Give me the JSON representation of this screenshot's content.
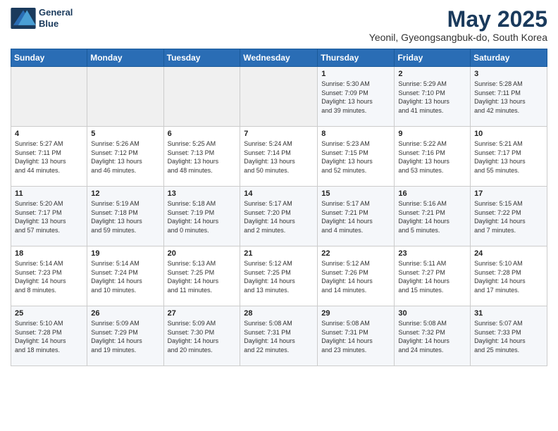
{
  "logo": {
    "line1": "General",
    "line2": "Blue"
  },
  "title": "May 2025",
  "subtitle": "Yeonil, Gyeongsangbuk-do, South Korea",
  "headers": [
    "Sunday",
    "Monday",
    "Tuesday",
    "Wednesday",
    "Thursday",
    "Friday",
    "Saturday"
  ],
  "weeks": [
    [
      {
        "day": "",
        "content": ""
      },
      {
        "day": "",
        "content": ""
      },
      {
        "day": "",
        "content": ""
      },
      {
        "day": "",
        "content": ""
      },
      {
        "day": "1",
        "content": "Sunrise: 5:30 AM\nSunset: 7:09 PM\nDaylight: 13 hours\nand 39 minutes."
      },
      {
        "day": "2",
        "content": "Sunrise: 5:29 AM\nSunset: 7:10 PM\nDaylight: 13 hours\nand 41 minutes."
      },
      {
        "day": "3",
        "content": "Sunrise: 5:28 AM\nSunset: 7:11 PM\nDaylight: 13 hours\nand 42 minutes."
      }
    ],
    [
      {
        "day": "4",
        "content": "Sunrise: 5:27 AM\nSunset: 7:11 PM\nDaylight: 13 hours\nand 44 minutes."
      },
      {
        "day": "5",
        "content": "Sunrise: 5:26 AM\nSunset: 7:12 PM\nDaylight: 13 hours\nand 46 minutes."
      },
      {
        "day": "6",
        "content": "Sunrise: 5:25 AM\nSunset: 7:13 PM\nDaylight: 13 hours\nand 48 minutes."
      },
      {
        "day": "7",
        "content": "Sunrise: 5:24 AM\nSunset: 7:14 PM\nDaylight: 13 hours\nand 50 minutes."
      },
      {
        "day": "8",
        "content": "Sunrise: 5:23 AM\nSunset: 7:15 PM\nDaylight: 13 hours\nand 52 minutes."
      },
      {
        "day": "9",
        "content": "Sunrise: 5:22 AM\nSunset: 7:16 PM\nDaylight: 13 hours\nand 53 minutes."
      },
      {
        "day": "10",
        "content": "Sunrise: 5:21 AM\nSunset: 7:17 PM\nDaylight: 13 hours\nand 55 minutes."
      }
    ],
    [
      {
        "day": "11",
        "content": "Sunrise: 5:20 AM\nSunset: 7:17 PM\nDaylight: 13 hours\nand 57 minutes."
      },
      {
        "day": "12",
        "content": "Sunrise: 5:19 AM\nSunset: 7:18 PM\nDaylight: 13 hours\nand 59 minutes."
      },
      {
        "day": "13",
        "content": "Sunrise: 5:18 AM\nSunset: 7:19 PM\nDaylight: 14 hours\nand 0 minutes."
      },
      {
        "day": "14",
        "content": "Sunrise: 5:17 AM\nSunset: 7:20 PM\nDaylight: 14 hours\nand 2 minutes."
      },
      {
        "day": "15",
        "content": "Sunrise: 5:17 AM\nSunset: 7:21 PM\nDaylight: 14 hours\nand 4 minutes."
      },
      {
        "day": "16",
        "content": "Sunrise: 5:16 AM\nSunset: 7:21 PM\nDaylight: 14 hours\nand 5 minutes."
      },
      {
        "day": "17",
        "content": "Sunrise: 5:15 AM\nSunset: 7:22 PM\nDaylight: 14 hours\nand 7 minutes."
      }
    ],
    [
      {
        "day": "18",
        "content": "Sunrise: 5:14 AM\nSunset: 7:23 PM\nDaylight: 14 hours\nand 8 minutes."
      },
      {
        "day": "19",
        "content": "Sunrise: 5:14 AM\nSunset: 7:24 PM\nDaylight: 14 hours\nand 10 minutes."
      },
      {
        "day": "20",
        "content": "Sunrise: 5:13 AM\nSunset: 7:25 PM\nDaylight: 14 hours\nand 11 minutes."
      },
      {
        "day": "21",
        "content": "Sunrise: 5:12 AM\nSunset: 7:25 PM\nDaylight: 14 hours\nand 13 minutes."
      },
      {
        "day": "22",
        "content": "Sunrise: 5:12 AM\nSunset: 7:26 PM\nDaylight: 14 hours\nand 14 minutes."
      },
      {
        "day": "23",
        "content": "Sunrise: 5:11 AM\nSunset: 7:27 PM\nDaylight: 14 hours\nand 15 minutes."
      },
      {
        "day": "24",
        "content": "Sunrise: 5:10 AM\nSunset: 7:28 PM\nDaylight: 14 hours\nand 17 minutes."
      }
    ],
    [
      {
        "day": "25",
        "content": "Sunrise: 5:10 AM\nSunset: 7:28 PM\nDaylight: 14 hours\nand 18 minutes."
      },
      {
        "day": "26",
        "content": "Sunrise: 5:09 AM\nSunset: 7:29 PM\nDaylight: 14 hours\nand 19 minutes."
      },
      {
        "day": "27",
        "content": "Sunrise: 5:09 AM\nSunset: 7:30 PM\nDaylight: 14 hours\nand 20 minutes."
      },
      {
        "day": "28",
        "content": "Sunrise: 5:08 AM\nSunset: 7:31 PM\nDaylight: 14 hours\nand 22 minutes."
      },
      {
        "day": "29",
        "content": "Sunrise: 5:08 AM\nSunset: 7:31 PM\nDaylight: 14 hours\nand 23 minutes."
      },
      {
        "day": "30",
        "content": "Sunrise: 5:08 AM\nSunset: 7:32 PM\nDaylight: 14 hours\nand 24 minutes."
      },
      {
        "day": "31",
        "content": "Sunrise: 5:07 AM\nSunset: 7:33 PM\nDaylight: 14 hours\nand 25 minutes."
      }
    ]
  ]
}
